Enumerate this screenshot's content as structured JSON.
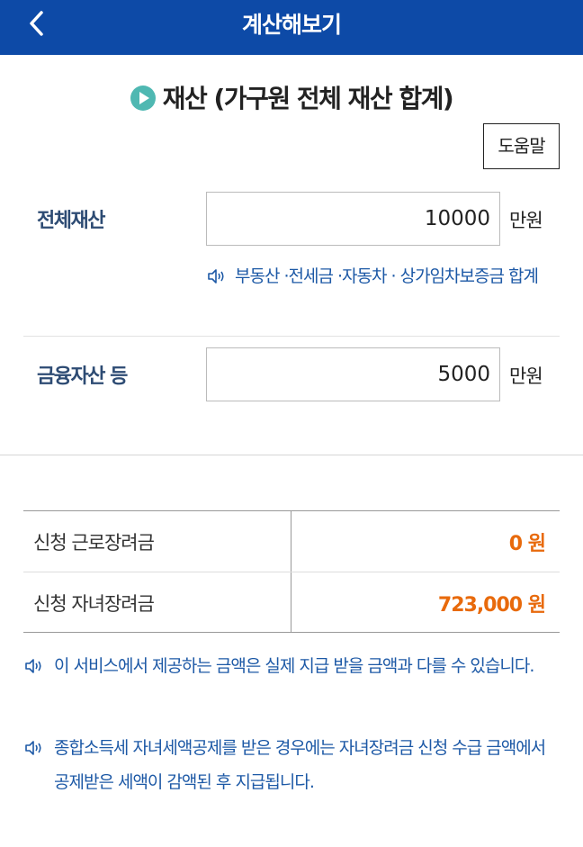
{
  "header": {
    "title": "계산해보기",
    "back_icon": "chevron-left-icon"
  },
  "section": {
    "title": "재산 (가구원 전체 재산 합계)",
    "icon": "play-circle-icon",
    "icon_color": "#4fb8b2"
  },
  "help_button": {
    "label": "도움말"
  },
  "fields": {
    "total_assets": {
      "label": "전체재산",
      "value": "10000",
      "unit": "만원"
    },
    "financial_assets": {
      "label": "금융자산 등",
      "value": "5000",
      "unit": "만원"
    }
  },
  "hint": {
    "icon": "speaker-icon",
    "text": "부동산 ·전세금 ·자동차 · 상가임차보증금 합계"
  },
  "results": [
    {
      "label": "신청 근로장려금",
      "value": "0 원"
    },
    {
      "label": "신청 자녀장려금",
      "value": "723,000 원"
    }
  ],
  "notes": [
    {
      "icon": "speaker-icon",
      "text": "이 서비스에서 제공하는 금액은 실제 지급 받을 금액과 다를 수 있습니다."
    },
    {
      "icon": "speaker-icon",
      "text": "종합소득세 자녀세액공제를 받은 경우에는 자녀장려금 신청 수급 금액에서 공제받은 세액이 감액된 후 지급됩니다."
    }
  ],
  "colors": {
    "header_bg": "#0d4aa7",
    "accent_blue": "#1d59a6",
    "result_orange": "#e86a0c",
    "label_navy": "#2d4b73"
  }
}
